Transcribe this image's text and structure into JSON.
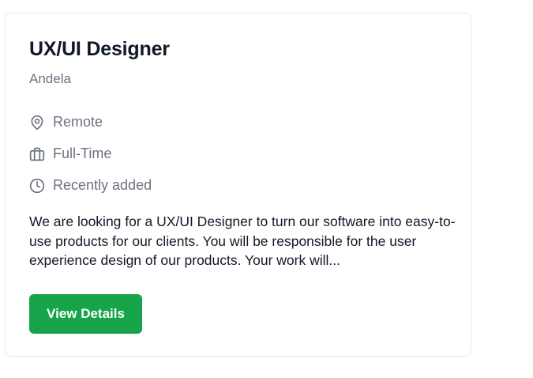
{
  "job": {
    "title": "UX/UI Designer",
    "company": "Andela",
    "location": "Remote",
    "employment_type": "Full-Time",
    "posted": "Recently added",
    "description": "We are looking for a UX/UI Designer to turn our software into easy-to-use products for our clients. You will be responsible for the user experience design of our products. Your work will...",
    "cta_label": "View Details"
  },
  "colors": {
    "button_bg": "#16a34a",
    "muted_text": "#6b7280",
    "body_text": "#111827",
    "card_border": "#e5e7eb"
  },
  "icons": {
    "location": "map-pin-icon",
    "employment_type": "briefcase-icon",
    "posted": "clock-icon"
  }
}
